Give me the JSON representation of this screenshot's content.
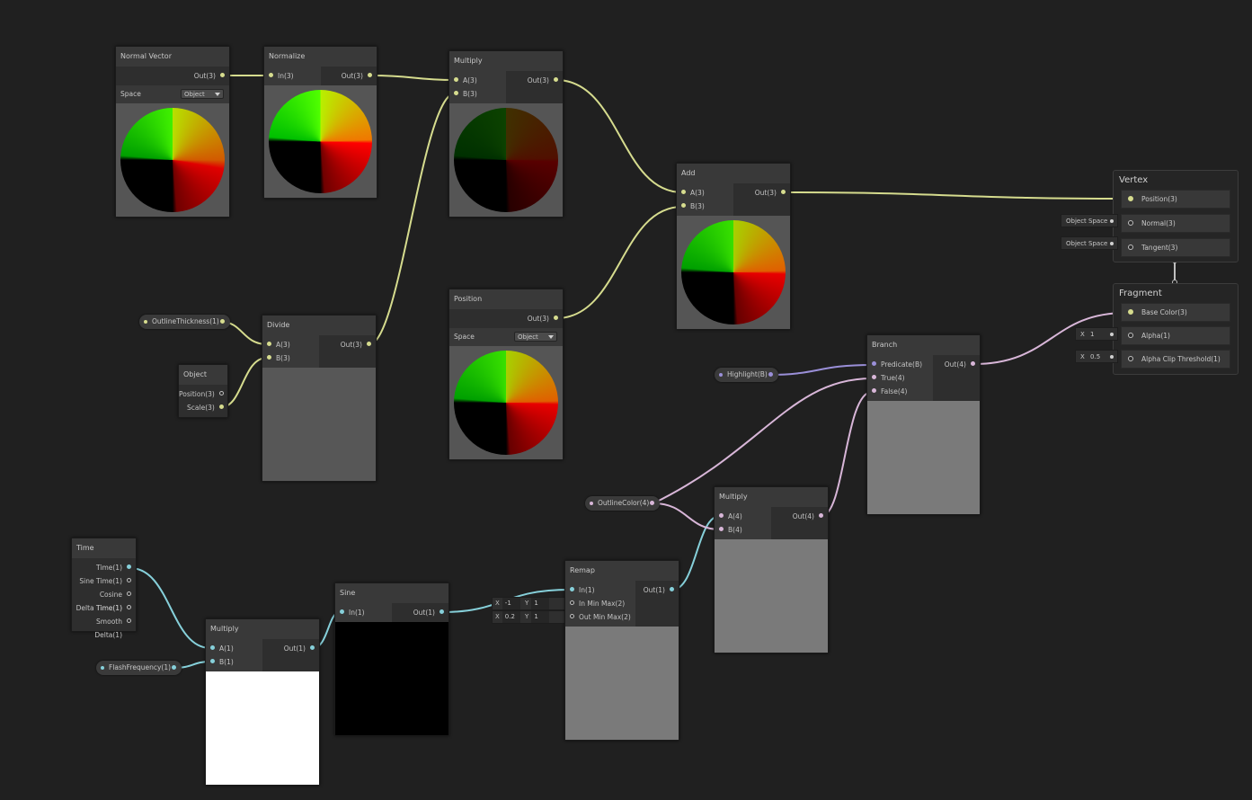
{
  "theme": {
    "background": "#202020",
    "vector3_color": "#d6dc8e",
    "vector1_color": "#86d0da",
    "vector4_color": "#d8b6d8",
    "boolean_color": "#9a8fd8"
  },
  "nodes": {
    "normal_vector": {
      "title": "Normal Vector",
      "out": "Out(3)",
      "space_label": "Space",
      "space_value": "Object"
    },
    "normalize": {
      "title": "Normalize",
      "in": "In(3)",
      "out": "Out(3)"
    },
    "multiply_top": {
      "title": "Multiply",
      "a": "A(3)",
      "b": "B(3)",
      "out": "Out(3)"
    },
    "add": {
      "title": "Add",
      "a": "A(3)",
      "b": "B(3)",
      "out": "Out(3)"
    },
    "position": {
      "title": "Position",
      "out": "Out(3)",
      "space_label": "Space",
      "space_value": "Object"
    },
    "divide": {
      "title": "Divide",
      "a": "A(3)",
      "b": "B(3)",
      "out": "Out(3)"
    },
    "object": {
      "title": "Object",
      "position": "Position(3)",
      "scale": "Scale(3)"
    },
    "time": {
      "title": "Time",
      "outputs": [
        "Time(1)",
        "Sine Time(1)",
        "Cosine Time(1)",
        "Delta Time(1)",
        "Smooth Delta(1)"
      ]
    },
    "multiply_bottom": {
      "title": "Multiply",
      "a": "A(1)",
      "b": "B(1)",
      "out": "Out(1)"
    },
    "sine": {
      "title": "Sine",
      "in": "In(1)",
      "out": "Out(1)"
    },
    "remap": {
      "title": "Remap",
      "in": "In(1)",
      "in_min_max": "In Min Max(2)",
      "out_min_max": "Out Min Max(2)",
      "out": "Out(1)"
    },
    "multiply_mid": {
      "title": "Multiply",
      "a": "A(4)",
      "b": "B(4)",
      "out": "Out(4)"
    },
    "branch": {
      "title": "Branch",
      "predicate": "Predicate(B)",
      "true": "True(4)",
      "false": "False(4)",
      "out": "Out(4)"
    }
  },
  "remap_fields": {
    "in_min": {
      "x_label": "X",
      "x": "-1",
      "y_label": "Y",
      "y": "1"
    },
    "out_min": {
      "x_label": "X",
      "x": "0.2",
      "y_label": "Y",
      "y": "1"
    }
  },
  "properties": {
    "outline_thickness": "OutlineThickness(1)",
    "flash_frequency": "FlashFrequency(1)",
    "outline_color": "OutlineColor(4)",
    "highlight": "Highlight(B)"
  },
  "master": {
    "vertex": {
      "title": "Vertex",
      "position": "Position(3)",
      "normal": "Normal(3)",
      "tangent": "Tangent(3)",
      "normal_source": "Object Space",
      "tangent_source": "Object Space"
    },
    "fragment": {
      "title": "Fragment",
      "base_color": "Base Color(3)",
      "alpha": "Alpha(1)",
      "alpha_clip": "Alpha Clip Threshold(1)",
      "alpha_x_label": "X",
      "alpha_value": "1",
      "alpha_clip_x_label": "X",
      "alpha_clip_value": "0.5"
    }
  }
}
